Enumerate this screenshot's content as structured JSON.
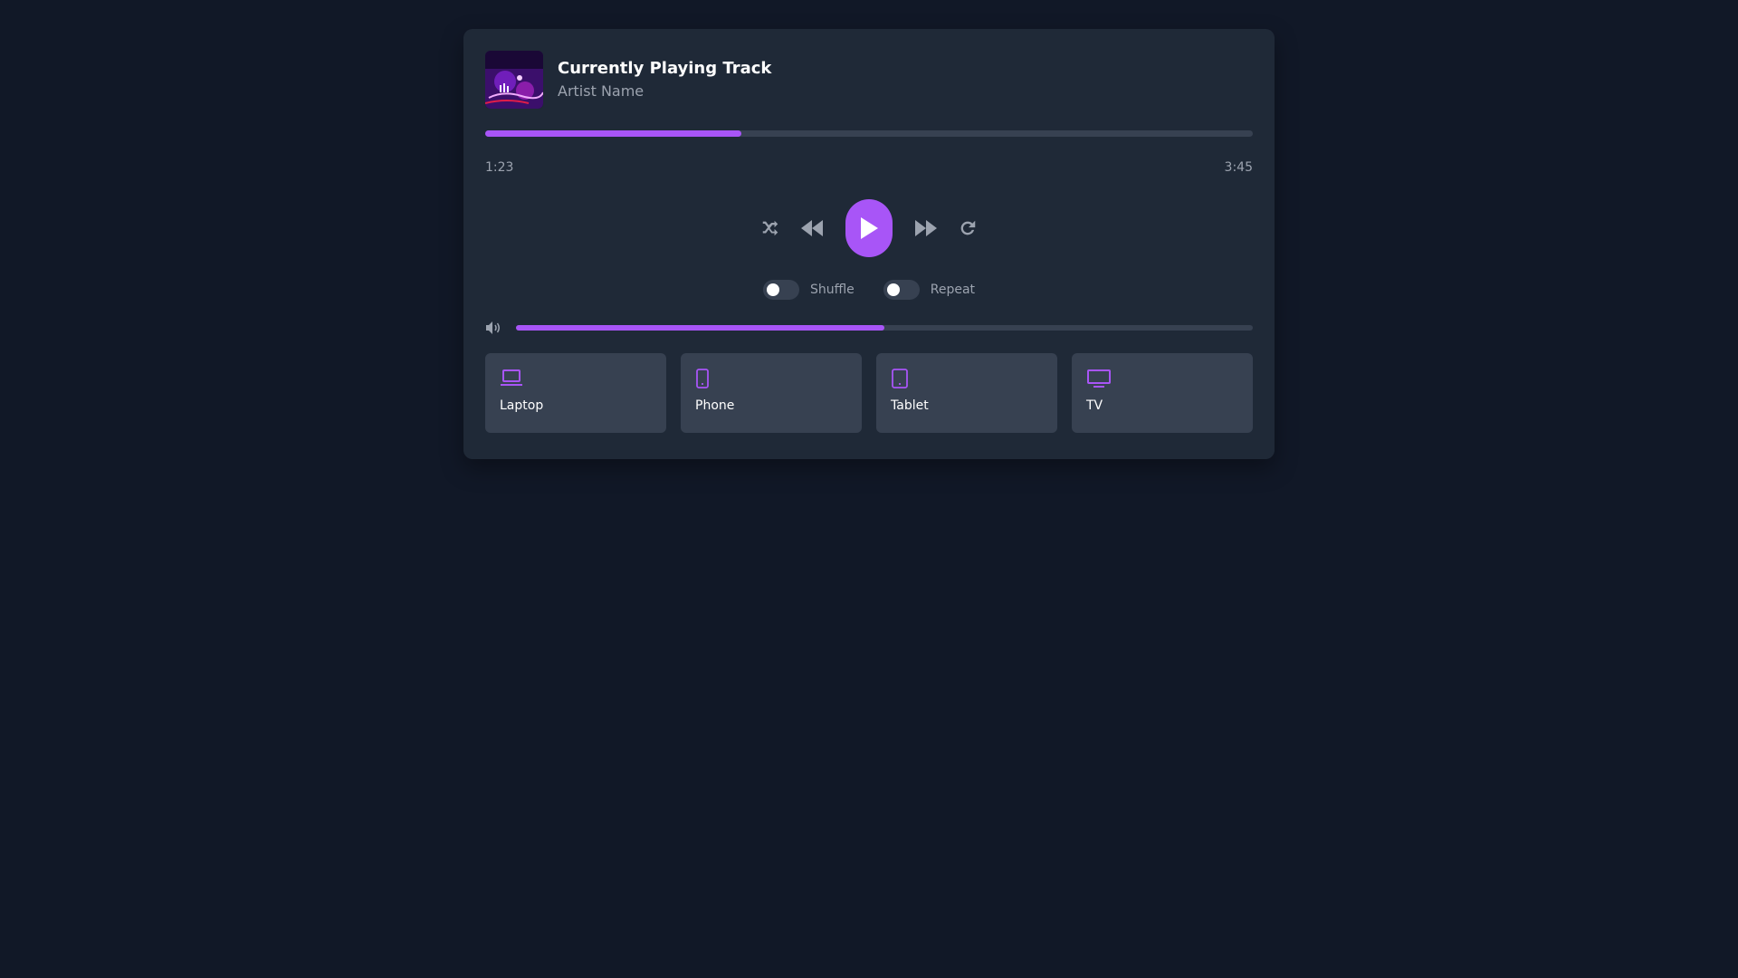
{
  "track": {
    "title": "Currently Playing Track",
    "artist": "Artist Name",
    "album_art_icon": "album-art-image"
  },
  "playback": {
    "elapsed": "1:23",
    "duration": "3:45",
    "progress_fraction": 0.334
  },
  "controls": {
    "shuffle_icon": "shuffle-icon",
    "rewind_icon": "rewind-icon",
    "play_icon": "play-icon",
    "forward_icon": "fast-forward-icon",
    "repeat_icon": "repeat-icon"
  },
  "toggles": [
    {
      "label": "Shuffle",
      "on": false
    },
    {
      "label": "Repeat",
      "on": false
    }
  ],
  "volume": {
    "icon": "volume-icon",
    "level_fraction": 0.5
  },
  "devices": [
    {
      "label": "Laptop",
      "icon": "laptop-icon"
    },
    {
      "label": "Phone",
      "icon": "phone-icon"
    },
    {
      "label": "Tablet",
      "icon": "tablet-icon"
    },
    {
      "label": "TV",
      "icon": "tv-icon"
    }
  ],
  "colors": {
    "accent": "#a855f7",
    "background": "#111827",
    "card": "#1f2937",
    "track": "#374151",
    "muted_text": "#9ca3af"
  }
}
